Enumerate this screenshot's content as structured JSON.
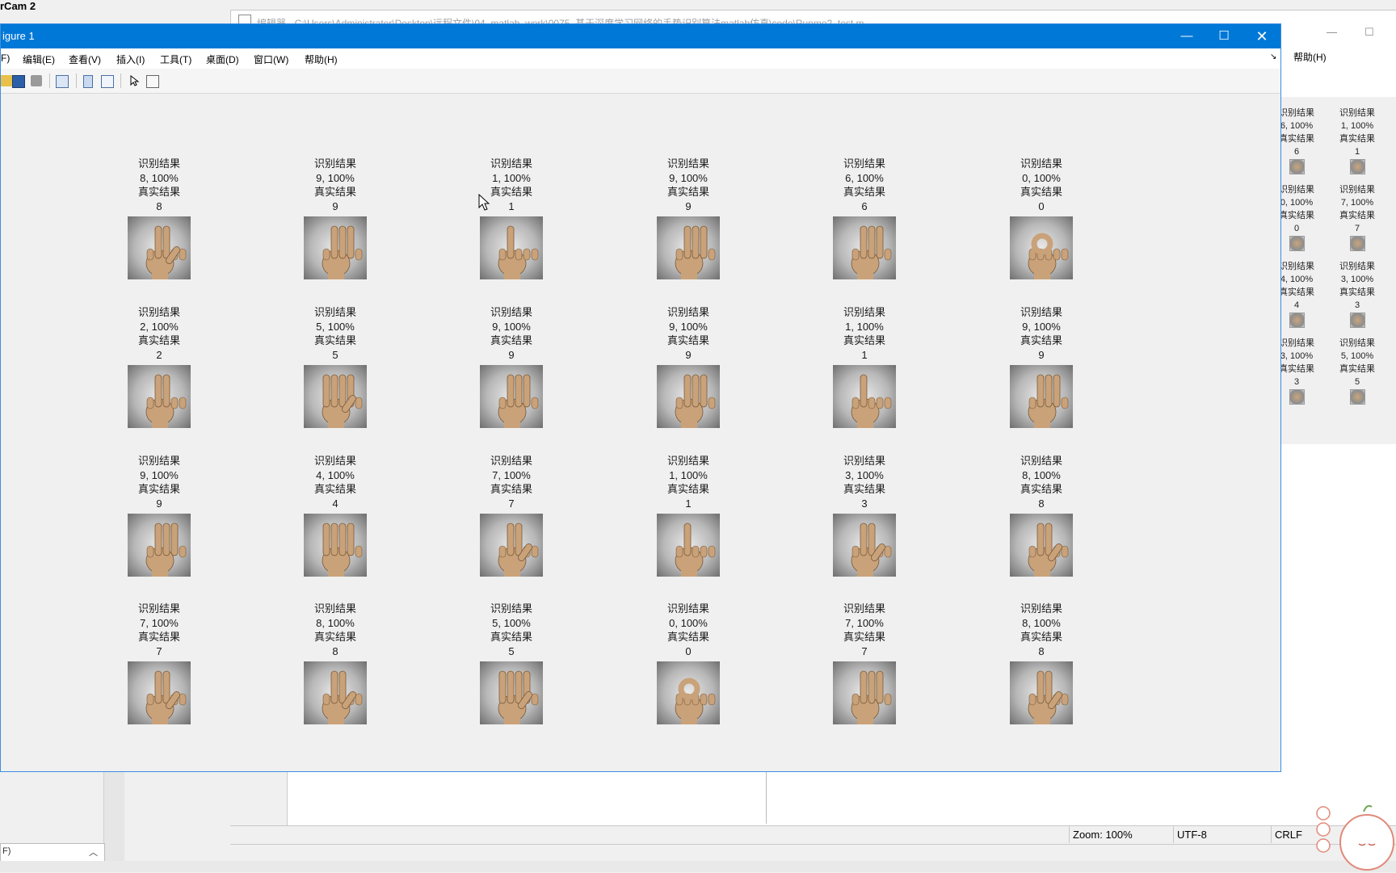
{
  "app": {
    "title": "rCam 2"
  },
  "background_window": {
    "title": "编辑器 - C:\\Users\\Administrator\\Desktop\\远程文件\\04_matlab_work\\0075_基于深度学习网络的手势识别算法matlab仿真\\code\\Runme2_test.m",
    "help_menu": "帮助(H)",
    "mini_plots": [
      {
        "l1": "识别结果",
        "l2": "6, 100%",
        "l3": "真实结果",
        "l4": "6"
      },
      {
        "l1": "识别结果",
        "l2": "1, 100%",
        "l3": "真实结果",
        "l4": "1"
      },
      {
        "l1": "识别结果",
        "l2": "0, 100%",
        "l3": "真实结果",
        "l4": "0"
      },
      {
        "l1": "识别结果",
        "l2": "7, 100%",
        "l3": "真实结果",
        "l4": "7"
      },
      {
        "l1": "识别结果",
        "l2": "4, 100%",
        "l3": "真实结果",
        "l4": "4"
      },
      {
        "l1": "识别结果",
        "l2": "3, 100%",
        "l3": "真实结果",
        "l4": "3"
      },
      {
        "l1": "识别结果",
        "l2": "3, 100%",
        "l3": "真实结果",
        "l4": "3"
      },
      {
        "l1": "识别结果",
        "l2": "5, 100%",
        "l3": "真实结果",
        "l4": "5"
      }
    ]
  },
  "status_bar": {
    "zoom": "Zoom: 100%",
    "encoding": "UTF-8",
    "line_ending": "CRLF"
  },
  "figure": {
    "title": "igure 1",
    "menus": [
      "F)",
      "编辑(E)",
      "查看(V)",
      "插入(I)",
      "工具(T)",
      "桌面(D)",
      "窗口(W)",
      "帮助(H)"
    ],
    "cells": [
      {
        "l1": "识别结果",
        "l2": "8, 100%",
        "l3": "真实结果",
        "l4": "8",
        "fingers": [
          0,
          1,
          1,
          0,
          0
        ],
        "thumb": 1
      },
      {
        "l1": "识别结果",
        "l2": "9, 100%",
        "l3": "真实结果",
        "l4": "9",
        "fingers": [
          0,
          1,
          1,
          1,
          0
        ],
        "thumb": 0
      },
      {
        "l1": "识别结果",
        "l2": "1, 100%",
        "l3": "真实结果",
        "l4": "1",
        "fingers": [
          0,
          1,
          0,
          0,
          0
        ],
        "thumb": 0
      },
      {
        "l1": "识别结果",
        "l2": "9, 100%",
        "l3": "真实结果",
        "l4": "9",
        "fingers": [
          0,
          1,
          1,
          1,
          0
        ],
        "thumb": 0
      },
      {
        "l1": "识别结果",
        "l2": "6, 100%",
        "l3": "真实结果",
        "l4": "6",
        "fingers": [
          0,
          1,
          1,
          1,
          0
        ],
        "thumb": 0
      },
      {
        "l1": "识别结果",
        "l2": "0, 100%",
        "l3": "真实结果",
        "l4": "0",
        "fingers": [
          0,
          0,
          0,
          0,
          0
        ],
        "thumb": 0
      },
      {
        "l1": "识别结果",
        "l2": "2, 100%",
        "l3": "真实结果",
        "l4": "2",
        "fingers": [
          0,
          1,
          1,
          0,
          0
        ],
        "thumb": 0
      },
      {
        "l1": "识别结果",
        "l2": "5, 100%",
        "l3": "真实结果",
        "l4": "5",
        "fingers": [
          1,
          1,
          1,
          1,
          0
        ],
        "thumb": 1
      },
      {
        "l1": "识别结果",
        "l2": "9, 100%",
        "l3": "真实结果",
        "l4": "9",
        "fingers": [
          0,
          1,
          1,
          1,
          0
        ],
        "thumb": 0
      },
      {
        "l1": "识别结果",
        "l2": "9, 100%",
        "l3": "真实结果",
        "l4": "9",
        "fingers": [
          0,
          1,
          1,
          1,
          0
        ],
        "thumb": 0
      },
      {
        "l1": "识别结果",
        "l2": "1, 100%",
        "l3": "真实结果",
        "l4": "1",
        "fingers": [
          0,
          1,
          0,
          0,
          0
        ],
        "thumb": 0
      },
      {
        "l1": "识别结果",
        "l2": "9, 100%",
        "l3": "真实结果",
        "l4": "9",
        "fingers": [
          0,
          1,
          1,
          1,
          0
        ],
        "thumb": 0
      },
      {
        "l1": "识别结果",
        "l2": "9, 100%",
        "l3": "真实结果",
        "l4": "9",
        "fingers": [
          0,
          1,
          1,
          1,
          0
        ],
        "thumb": 0
      },
      {
        "l1": "识别结果",
        "l2": "4, 100%",
        "l3": "真实结果",
        "l4": "4",
        "fingers": [
          1,
          1,
          1,
          1,
          0
        ],
        "thumb": 0
      },
      {
        "l1": "识别结果",
        "l2": "7, 100%",
        "l3": "真实结果",
        "l4": "7",
        "fingers": [
          0,
          1,
          1,
          0,
          0
        ],
        "thumb": 1
      },
      {
        "l1": "识别结果",
        "l2": "1, 100%",
        "l3": "真实结果",
        "l4": "1",
        "fingers": [
          0,
          1,
          0,
          0,
          0
        ],
        "thumb": 0
      },
      {
        "l1": "识别结果",
        "l2": "3, 100%",
        "l3": "真实结果",
        "l4": "3",
        "fingers": [
          0,
          1,
          1,
          0,
          0
        ],
        "thumb": 1
      },
      {
        "l1": "识别结果",
        "l2": "8, 100%",
        "l3": "真实结果",
        "l4": "8",
        "fingers": [
          0,
          1,
          1,
          0,
          0
        ],
        "thumb": 1
      },
      {
        "l1": "识别结果",
        "l2": "7, 100%",
        "l3": "真实结果",
        "l4": "7",
        "fingers": [
          0,
          1,
          1,
          0,
          0
        ],
        "thumb": 1
      },
      {
        "l1": "识别结果",
        "l2": "8, 100%",
        "l3": "真实结果",
        "l4": "8",
        "fingers": [
          0,
          1,
          1,
          0,
          0
        ],
        "thumb": 1
      },
      {
        "l1": "识别结果",
        "l2": "5, 100%",
        "l3": "真实结果",
        "l4": "5",
        "fingers": [
          1,
          1,
          1,
          1,
          0
        ],
        "thumb": 1
      },
      {
        "l1": "识别结果",
        "l2": "0, 100%",
        "l3": "真实结果",
        "l4": "0",
        "fingers": [
          0,
          0,
          0,
          0,
          0
        ],
        "thumb": 0
      },
      {
        "l1": "识别结果",
        "l2": "7, 100%",
        "l3": "真实结果",
        "l4": "7",
        "fingers": [
          0,
          1,
          1,
          1,
          0
        ],
        "thumb": 0
      },
      {
        "l1": "识别结果",
        "l2": "8, 100%",
        "l3": "真实结果",
        "l4": "8",
        "fingers": [
          0,
          1,
          1,
          0,
          0
        ],
        "thumb": 1
      }
    ]
  },
  "colors": {
    "titlebar": "#0078d7",
    "skin": "#c9a27a",
    "plot_bg": "#f0f0f0"
  }
}
